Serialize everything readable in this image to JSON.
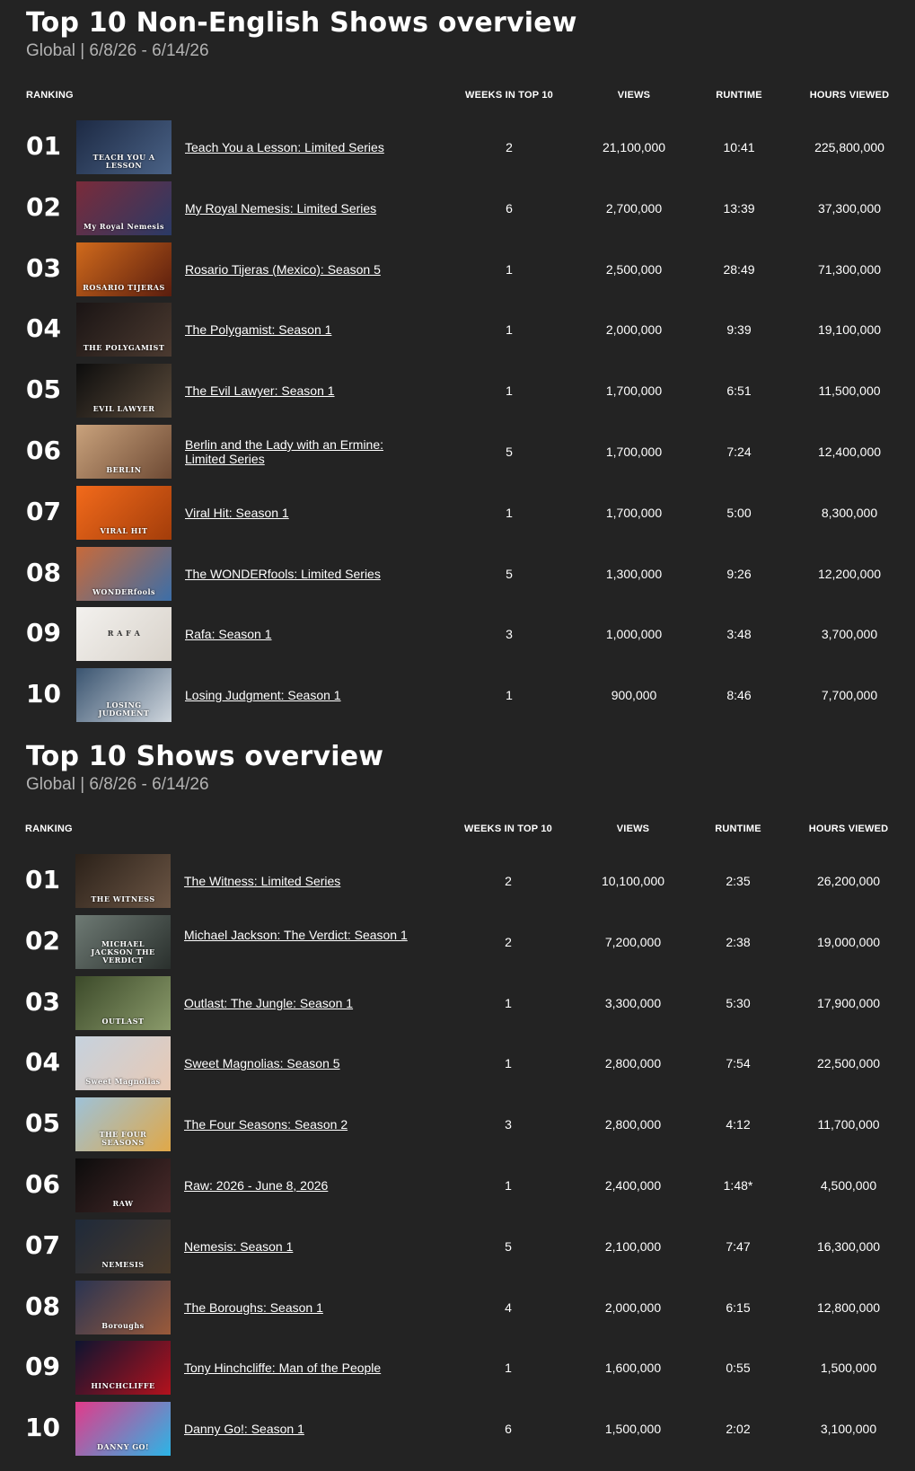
{
  "sections": [
    {
      "title": "Top 10 Non-English Shows overview",
      "subtitle": "Global | 6/8/26 - 6/14/26",
      "columns": {
        "ranking": "RANKING",
        "weeks": "WEEKS IN TOP 10",
        "views": "VIEWS",
        "runtime": "RUNTIME",
        "hours": "HOURS VIEWED"
      },
      "rows": [
        {
          "rank": "01",
          "title": "Teach You a Lesson: Limited Series",
          "weeks": "2",
          "views": "21,100,000",
          "runtime": "10:41",
          "hours": "225,800,000",
          "thumb_text": "TEACH YOU A LESSON",
          "thumb_colors": [
            "#1d2a44",
            "#4a6286"
          ]
        },
        {
          "rank": "02",
          "title": "My Royal Nemesis: Limited Series",
          "weeks": "6",
          "views": "2,700,000",
          "runtime": "13:39",
          "hours": "37,300,000",
          "thumb_text": "My Royal Nemesis",
          "thumb_colors": [
            "#7a2b3a",
            "#2a3a66"
          ]
        },
        {
          "rank": "03",
          "title": "Rosario Tijeras (Mexico): Season 5",
          "weeks": "1",
          "views": "2,500,000",
          "runtime": "28:49",
          "hours": "71,300,000",
          "thumb_text": "ROSARIO TIJERAS",
          "thumb_colors": [
            "#d06a1c",
            "#5a1d0e"
          ]
        },
        {
          "rank": "04",
          "title": "The Polygamist: Season 1",
          "weeks": "1",
          "views": "2,000,000",
          "runtime": "9:39",
          "hours": "19,100,000",
          "thumb_text": "THE POLYGAMIST",
          "thumb_colors": [
            "#1a1414",
            "#4b3a30"
          ]
        },
        {
          "rank": "05",
          "title": "The Evil Lawyer: Season 1",
          "weeks": "1",
          "views": "1,700,000",
          "runtime": "6:51",
          "hours": "11,500,000",
          "thumb_text": "EVIL LAWYER",
          "thumb_colors": [
            "#0d0d0d",
            "#5a4a3a"
          ]
        },
        {
          "rank": "06",
          "title": "Berlin and the Lady with an Ermine: Limited Series",
          "weeks": "5",
          "views": "1,700,000",
          "runtime": "7:24",
          "hours": "12,400,000",
          "thumb_text": "BERLIN",
          "thumb_colors": [
            "#c9a27c",
            "#6e4a34"
          ]
        },
        {
          "rank": "07",
          "title": "Viral Hit: Season 1",
          "weeks": "1",
          "views": "1,700,000",
          "runtime": "5:00",
          "hours": "8,300,000",
          "thumb_text": "VIRAL HIT",
          "thumb_colors": [
            "#f26a1b",
            "#a33d0a"
          ]
        },
        {
          "rank": "08",
          "title": "The WONDERfools: Limited Series",
          "weeks": "5",
          "views": "1,300,000",
          "runtime": "9:26",
          "hours": "12,200,000",
          "thumb_text": "WONDERfools",
          "thumb_colors": [
            "#c86a3a",
            "#3c6ea8"
          ]
        },
        {
          "rank": "09",
          "title": "Rafa: Season 1",
          "weeks": "3",
          "views": "1,000,000",
          "runtime": "3:48",
          "hours": "3,700,000",
          "thumb_text": "R A F A",
          "thumb_colors": [
            "#f3f1ee",
            "#d8d2ca"
          ]
        },
        {
          "rank": "10",
          "title": "Losing Judgment: Season 1",
          "weeks": "1",
          "views": "900,000",
          "runtime": "8:46",
          "hours": "7,700,000",
          "thumb_text": "LOSING JUDGMENT",
          "thumb_colors": [
            "#3a5470",
            "#cfd6dd"
          ]
        }
      ]
    },
    {
      "title": "Top 10 Shows overview",
      "subtitle": "Global | 6/8/26 - 6/14/26",
      "columns": {
        "ranking": "RANKING",
        "weeks": "WEEKS IN TOP 10",
        "views": "VIEWS",
        "runtime": "RUNTIME",
        "hours": "HOURS VIEWED"
      },
      "rows": [
        {
          "rank": "01",
          "title": "The Witness: Limited Series",
          "weeks": "2",
          "views": "10,100,000",
          "runtime": "2:35",
          "hours": "26,200,000",
          "thumb_text": "THE WITNESS",
          "thumb_colors": [
            "#2b2119",
            "#6b5544"
          ]
        },
        {
          "rank": "02",
          "title": "Michael Jackson: The Verdict: Season 1",
          "weeks": "2",
          "views": "7,200,000",
          "runtime": "2:38",
          "hours": "19,000,000",
          "thumb_text": "MICHAEL JACKSON THE VERDICT",
          "thumb_colors": [
            "#6e7a74",
            "#2a302d"
          ]
        },
        {
          "rank": "03",
          "title": "Outlast: The Jungle: Season 1",
          "weeks": "1",
          "views": "3,300,000",
          "runtime": "5:30",
          "hours": "17,900,000",
          "thumb_text": "OUTLAST",
          "thumb_colors": [
            "#3c4a2a",
            "#8a9a6a"
          ]
        },
        {
          "rank": "04",
          "title": "Sweet Magnolias: Season 5",
          "weeks": "1",
          "views": "2,800,000",
          "runtime": "7:54",
          "hours": "22,500,000",
          "thumb_text": "Sweet Magnolias",
          "thumb_colors": [
            "#c6d2de",
            "#e8c9b4"
          ]
        },
        {
          "rank": "05",
          "title": "The Four Seasons: Season 2",
          "weeks": "3",
          "views": "2,800,000",
          "runtime": "4:12",
          "hours": "11,700,000",
          "thumb_text": "THE FOUR SEASONS",
          "thumb_colors": [
            "#9ec2d8",
            "#e0a848"
          ]
        },
        {
          "rank": "06",
          "title": "Raw: 2026 - June 8, 2026",
          "weeks": "1",
          "views": "2,400,000",
          "runtime": "1:48*",
          "hours": "4,500,000",
          "thumb_text": "RAW",
          "thumb_colors": [
            "#0c0c0c",
            "#4a2a2a"
          ]
        },
        {
          "rank": "07",
          "title": "Nemesis: Season 1",
          "weeks": "5",
          "views": "2,100,000",
          "runtime": "7:47",
          "hours": "16,300,000",
          "thumb_text": "NEMESIS",
          "thumb_colors": [
            "#1f2a3a",
            "#4a3a2a"
          ]
        },
        {
          "rank": "08",
          "title": "The Boroughs: Season 1",
          "weeks": "4",
          "views": "2,000,000",
          "runtime": "6:15",
          "hours": "12,800,000",
          "thumb_text": "Boroughs",
          "thumb_colors": [
            "#2a3452",
            "#9a5a3a"
          ]
        },
        {
          "rank": "09",
          "title": "Tony Hinchcliffe: Man of the People",
          "weeks": "1",
          "views": "1,600,000",
          "runtime": "0:55",
          "hours": "1,500,000",
          "thumb_text": "HINCHCLIFFE",
          "thumb_colors": [
            "#0e1430",
            "#b3121d"
          ]
        },
        {
          "rank": "10",
          "title": "Danny Go!: Season 1",
          "weeks": "6",
          "views": "1,500,000",
          "runtime": "2:02",
          "hours": "3,100,000",
          "thumb_text": "DANNY GO!",
          "thumb_colors": [
            "#e23a8a",
            "#2bb5e6"
          ]
        }
      ]
    }
  ]
}
